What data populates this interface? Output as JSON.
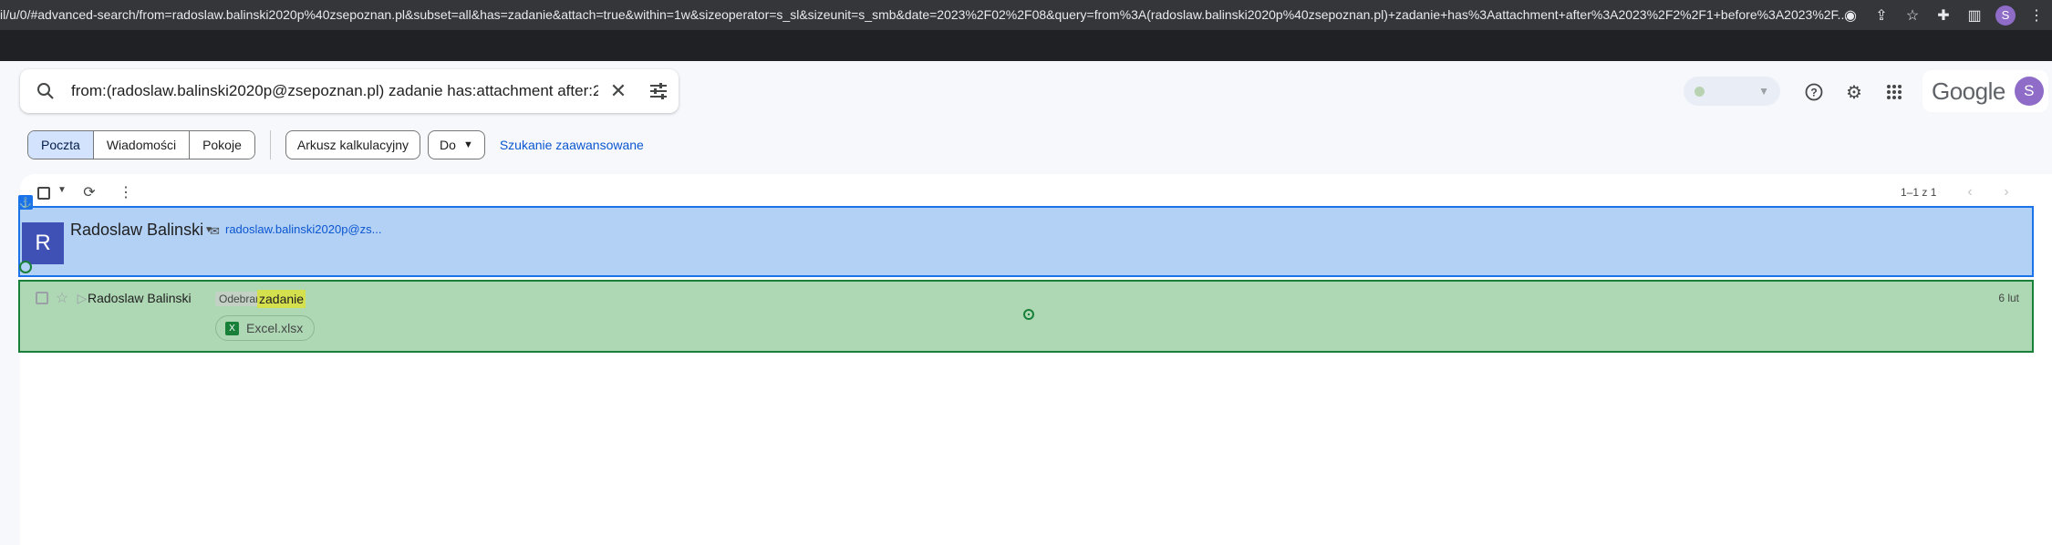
{
  "browser": {
    "url": "il/u/0/#advanced-search/from=radoslaw.balinski2020p%40zsepoznan.pl&subset=all&has=zadanie&attach=true&within=1w&sizeoperator=s_sl&sizeunit=s_smb&date=2023%2F02%2F08&query=from%3A(radoslaw.balinski2020p%40zsepoznan.pl)+zadanie+has%3Aattachment+after%3A2023%2F2%2F1+before%3A2023%2F...",
    "profile_initial": "S"
  },
  "search": {
    "query": "from:(radoslaw.balinski2020p@zsepoznan.pl) zadanie has:attachment after:20"
  },
  "header": {
    "logo_text": "Google",
    "avatar_initial": "S"
  },
  "filters": {
    "segments": [
      "Poczta",
      "Wiadomości",
      "Pokoje"
    ],
    "active_segment": "Poczta",
    "chip_spreadsheet": "Arkusz kalkulacyjny",
    "chip_to": "Do",
    "advanced_link": "Szukanie zaawansowane"
  },
  "toolbar": {
    "pager": "1–1 z 1"
  },
  "contact": {
    "initial": "R",
    "name": "Radoslaw Balinski",
    "email": "radoslaw.balinski2020p@zs..."
  },
  "message": {
    "sender": "Radoslaw Balinski",
    "label": "Odebrane",
    "subject": "zadanie",
    "attachment": "Excel.xlsx",
    "attachment_icon_letter": "X",
    "date": "6 lut"
  },
  "colors": {
    "accent": "#0b57d0",
    "contact_highlight": "#b3d0f5",
    "row_highlight": "#aed7b4",
    "avatar": "#3f51b5",
    "excel": "#188038"
  }
}
